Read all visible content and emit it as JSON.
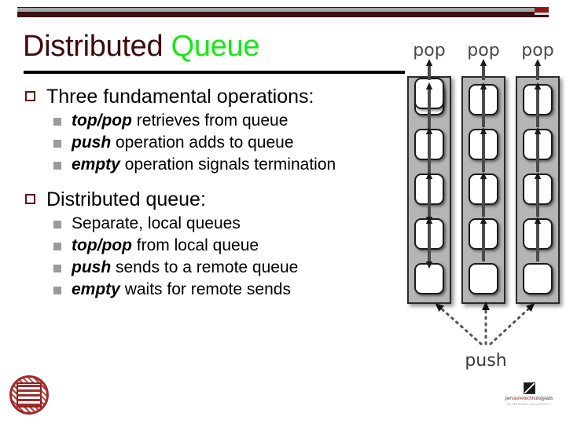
{
  "slide": {
    "title_main": "Distributed",
    "title_accent": "Queue",
    "title_accent_color": "#19e619",
    "title_main_color": "#3d0c0c"
  },
  "content": {
    "sections": [
      {
        "heading": "Three fundamental operations:",
        "items": [
          {
            "emphasis": "top/pop",
            "rest": " retrieves from queue"
          },
          {
            "emphasis": "push",
            "rest": " operation adds to queue"
          },
          {
            "emphasis": "empty",
            "rest": " operation signals termination"
          }
        ]
      },
      {
        "heading": "Distributed queue:",
        "items": [
          {
            "emphasis": "",
            "rest": "Separate, local queues"
          },
          {
            "emphasis": "top/pop",
            "rest": " from local queue"
          },
          {
            "emphasis": "push",
            "rest": " sends to a remote queue"
          },
          {
            "emphasis": "empty",
            "rest": " waits for remote sends"
          }
        ]
      }
    ]
  },
  "diagram": {
    "pop_labels": [
      "pop",
      "pop",
      "pop"
    ],
    "push_label": "push",
    "column_count": 3,
    "boxes_per_column": 5
  },
  "footer": {
    "lab_name_a": "per",
    "lab_name_b": "vasive",
    "lab_name_c": "techno",
    "lab_name_d": "logy",
    "lab_name_e": "labs",
    "lab_sub": "AT MERAAN UNIVERSITY"
  }
}
